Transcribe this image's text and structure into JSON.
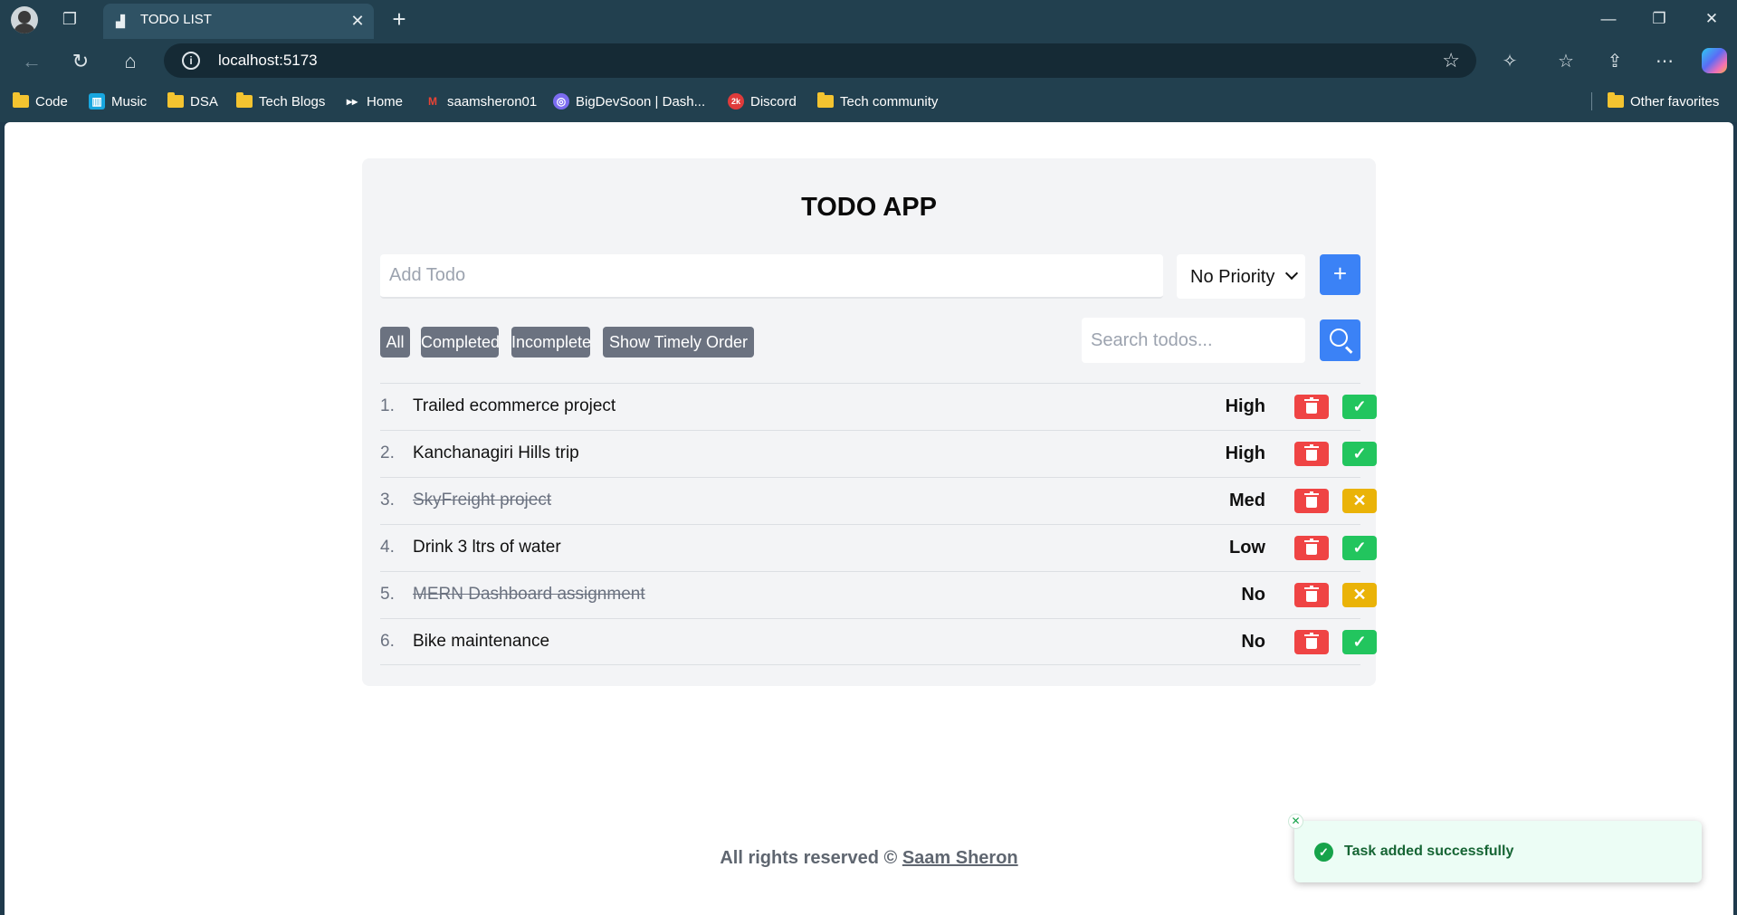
{
  "browser": {
    "tab_title": "TODO LIST",
    "url": "localhost:5173",
    "bookmarks": [
      {
        "label": "Code",
        "type": "folder"
      },
      {
        "label": "Music",
        "type": "site"
      },
      {
        "label": "DSA",
        "type": "folder"
      },
      {
        "label": "Tech Blogs",
        "type": "folder"
      },
      {
        "label": "Home",
        "type": "site"
      },
      {
        "label": "saamsheron01",
        "type": "site"
      },
      {
        "label": "BigDevSoon | Dash...",
        "type": "site"
      },
      {
        "label": "Discord",
        "type": "site"
      },
      {
        "label": "Tech community",
        "type": "folder"
      }
    ],
    "other_favorites": "Other favorites"
  },
  "app": {
    "title": "TODO APP",
    "add_placeholder": "Add Todo",
    "priority_selected": "No Priority",
    "add_button": "+",
    "filters": [
      "All",
      "Completed",
      "Incomplete",
      "Show Timely Order"
    ],
    "search_placeholder": "Search todos...",
    "todos": [
      {
        "num": "1.",
        "text": "Trailed ecommerce project",
        "priority": "High",
        "completed": false
      },
      {
        "num": "2.",
        "text": "Kanchanagiri Hills trip",
        "priority": "High",
        "completed": false
      },
      {
        "num": "3.",
        "text": "SkyFreight project",
        "priority": "Med",
        "completed": true
      },
      {
        "num": "4.",
        "text": "Drink 3 ltrs of water",
        "priority": "Low",
        "completed": false
      },
      {
        "num": "5.",
        "text": "MERN Dashboard assignment",
        "priority": "No",
        "completed": true
      },
      {
        "num": "6.",
        "text": "Bike maintenance",
        "priority": "No",
        "completed": false
      }
    ]
  },
  "footer": {
    "text": "All rights reserved © ",
    "author": "Saam Sheron"
  },
  "toast": {
    "message": "Task added successfully"
  },
  "colors": {
    "accent": "#3b82f6",
    "delete": "#ef4444",
    "complete": "#22c55e",
    "undo": "#eab308",
    "filter": "#6b7280"
  }
}
